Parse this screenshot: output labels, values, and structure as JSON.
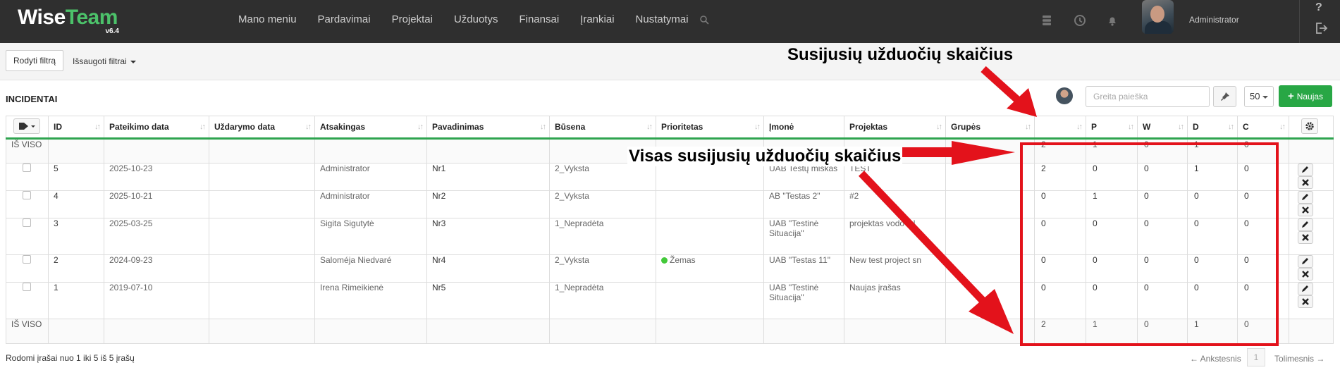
{
  "app": {
    "logo_wise": "Wise",
    "logo_team": "Team",
    "version": "v6.4",
    "user": "Administrator"
  },
  "nav": {
    "items": [
      "Mano meniu",
      "Pardavimai",
      "Projektai",
      "Užduotys",
      "Finansai",
      "Įrankiai",
      "Nustatymai"
    ]
  },
  "filters": {
    "show_label": "Rodyti filtrą",
    "saved_label": "Išsaugoti filtrai"
  },
  "page": {
    "title": "INCIDENTAI"
  },
  "search": {
    "placeholder": "Greita paieška"
  },
  "perpage": "50",
  "new_label": "Naujas",
  "table": {
    "headers": [
      "ID",
      "Pateikimo data",
      "Uždarymo data",
      "Atsakingas",
      "Pavadinimas",
      "Būsena",
      "Prioritetas",
      "Įmonė",
      "Projektas",
      "Grupės",
      "",
      "P",
      "W",
      "D",
      "C"
    ],
    "total_label": "IŠ VISO",
    "totals": [
      "2",
      "1",
      "0",
      "1",
      "0"
    ],
    "rows": [
      {
        "id": "5",
        "date": "2025-10-23",
        "closed": "",
        "owner": "Administrator",
        "name": "Nr1",
        "status": "2_Vyksta",
        "priority": "",
        "company": "UAB Testų miškas",
        "project": "TEST",
        "groups": "",
        "counts": [
          "2",
          "0",
          "0",
          "1",
          "0"
        ]
      },
      {
        "id": "4",
        "date": "2025-10-21",
        "closed": "",
        "owner": "Administrator",
        "name": "Nr2",
        "status": "2_Vyksta",
        "priority": "",
        "company": "AB \"Testas 2\"",
        "project": "#2",
        "groups": "",
        "counts": [
          "0",
          "1",
          "0",
          "0",
          "0"
        ]
      },
      {
        "id": "3",
        "date": "2025-03-25",
        "closed": "",
        "owner": "Sigita Sigutytė",
        "name": "Nr3",
        "status": "1_Nepradėta",
        "priority": "",
        "company": "UAB \"Testinė Situacija\"",
        "project": "projektas vodovul",
        "groups": "",
        "counts": [
          "0",
          "0",
          "0",
          "0",
          "0"
        ]
      },
      {
        "id": "2",
        "date": "2024-09-23",
        "closed": "",
        "owner": "Saloméja Niedvaré",
        "name": "Nr4",
        "status": "2_Vyksta",
        "priority": "Žemas",
        "company": "UAB \"Testas 11\"",
        "project": "New test project sn",
        "groups": "",
        "counts": [
          "0",
          "0",
          "0",
          "0",
          "0"
        ]
      },
      {
        "id": "1",
        "date": "2019-07-10",
        "closed": "",
        "owner": "Irena Rimeikienė",
        "name": "Nr5",
        "status": "1_Nepradėta",
        "priority": "",
        "company": "UAB \"Testinė Situacija\"",
        "project": "Naujas įrašas",
        "groups": "",
        "counts": [
          "0",
          "0",
          "0",
          "0",
          "0"
        ]
      }
    ]
  },
  "footer": {
    "info": "Rodomi įrašai nuo 1 iki 5 iš 5 įrašų",
    "prev": "← Ankstesnis",
    "page": "1",
    "next": "Tolimesnis →"
  },
  "annotations": {
    "top": "Susijusių užduočių skaičius",
    "middle": "Visas susijusių užduočių skaičius",
    "color": "#e3121b"
  },
  "colors": {
    "navbar": "#2f2f2f",
    "brand_green": "#4cc26a",
    "new_button": "#28a745",
    "header_underline": "#2ea44f",
    "priority_low": "#43c93a"
  }
}
